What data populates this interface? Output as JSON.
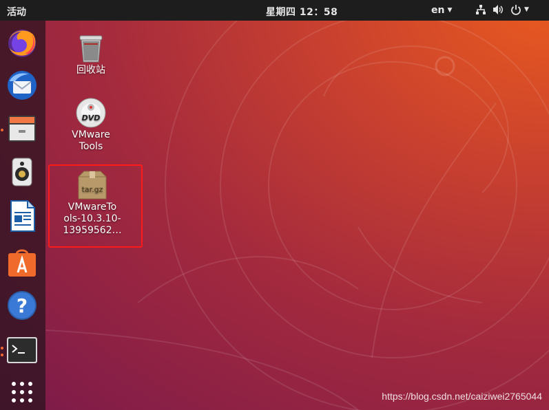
{
  "topbar": {
    "activities": "活动",
    "clock": "星期四 12：58",
    "language": "en",
    "icons": [
      "network-icon",
      "volume-icon",
      "power-icon"
    ]
  },
  "dock": {
    "apps": [
      "firefox-icon",
      "thunderbird-icon",
      "files-icon",
      "rhythmbox-icon",
      "libreoffice-writer-icon",
      "software-center-icon",
      "help-icon",
      "terminal-icon",
      "show-apps-icon"
    ],
    "accent_color": "#f26a32"
  },
  "desktop": {
    "icons": [
      {
        "label": "回收站"
      },
      {
        "label": "VMware Tools",
        "badge": "DVD"
      },
      {
        "label_lines": [
          "VMwareTo",
          "ols-10.3.10-",
          "13959562…"
        ],
        "badge": "tar.gz"
      }
    ]
  },
  "watermark": "https://blog.csdn.net/caiziwei2765044",
  "colors": {
    "wallpaper_top": "#e95a1f",
    "wallpaper_bottom": "#7b1a4a",
    "topbar": "#1d1d1d",
    "selection": "#ff1a1a"
  }
}
